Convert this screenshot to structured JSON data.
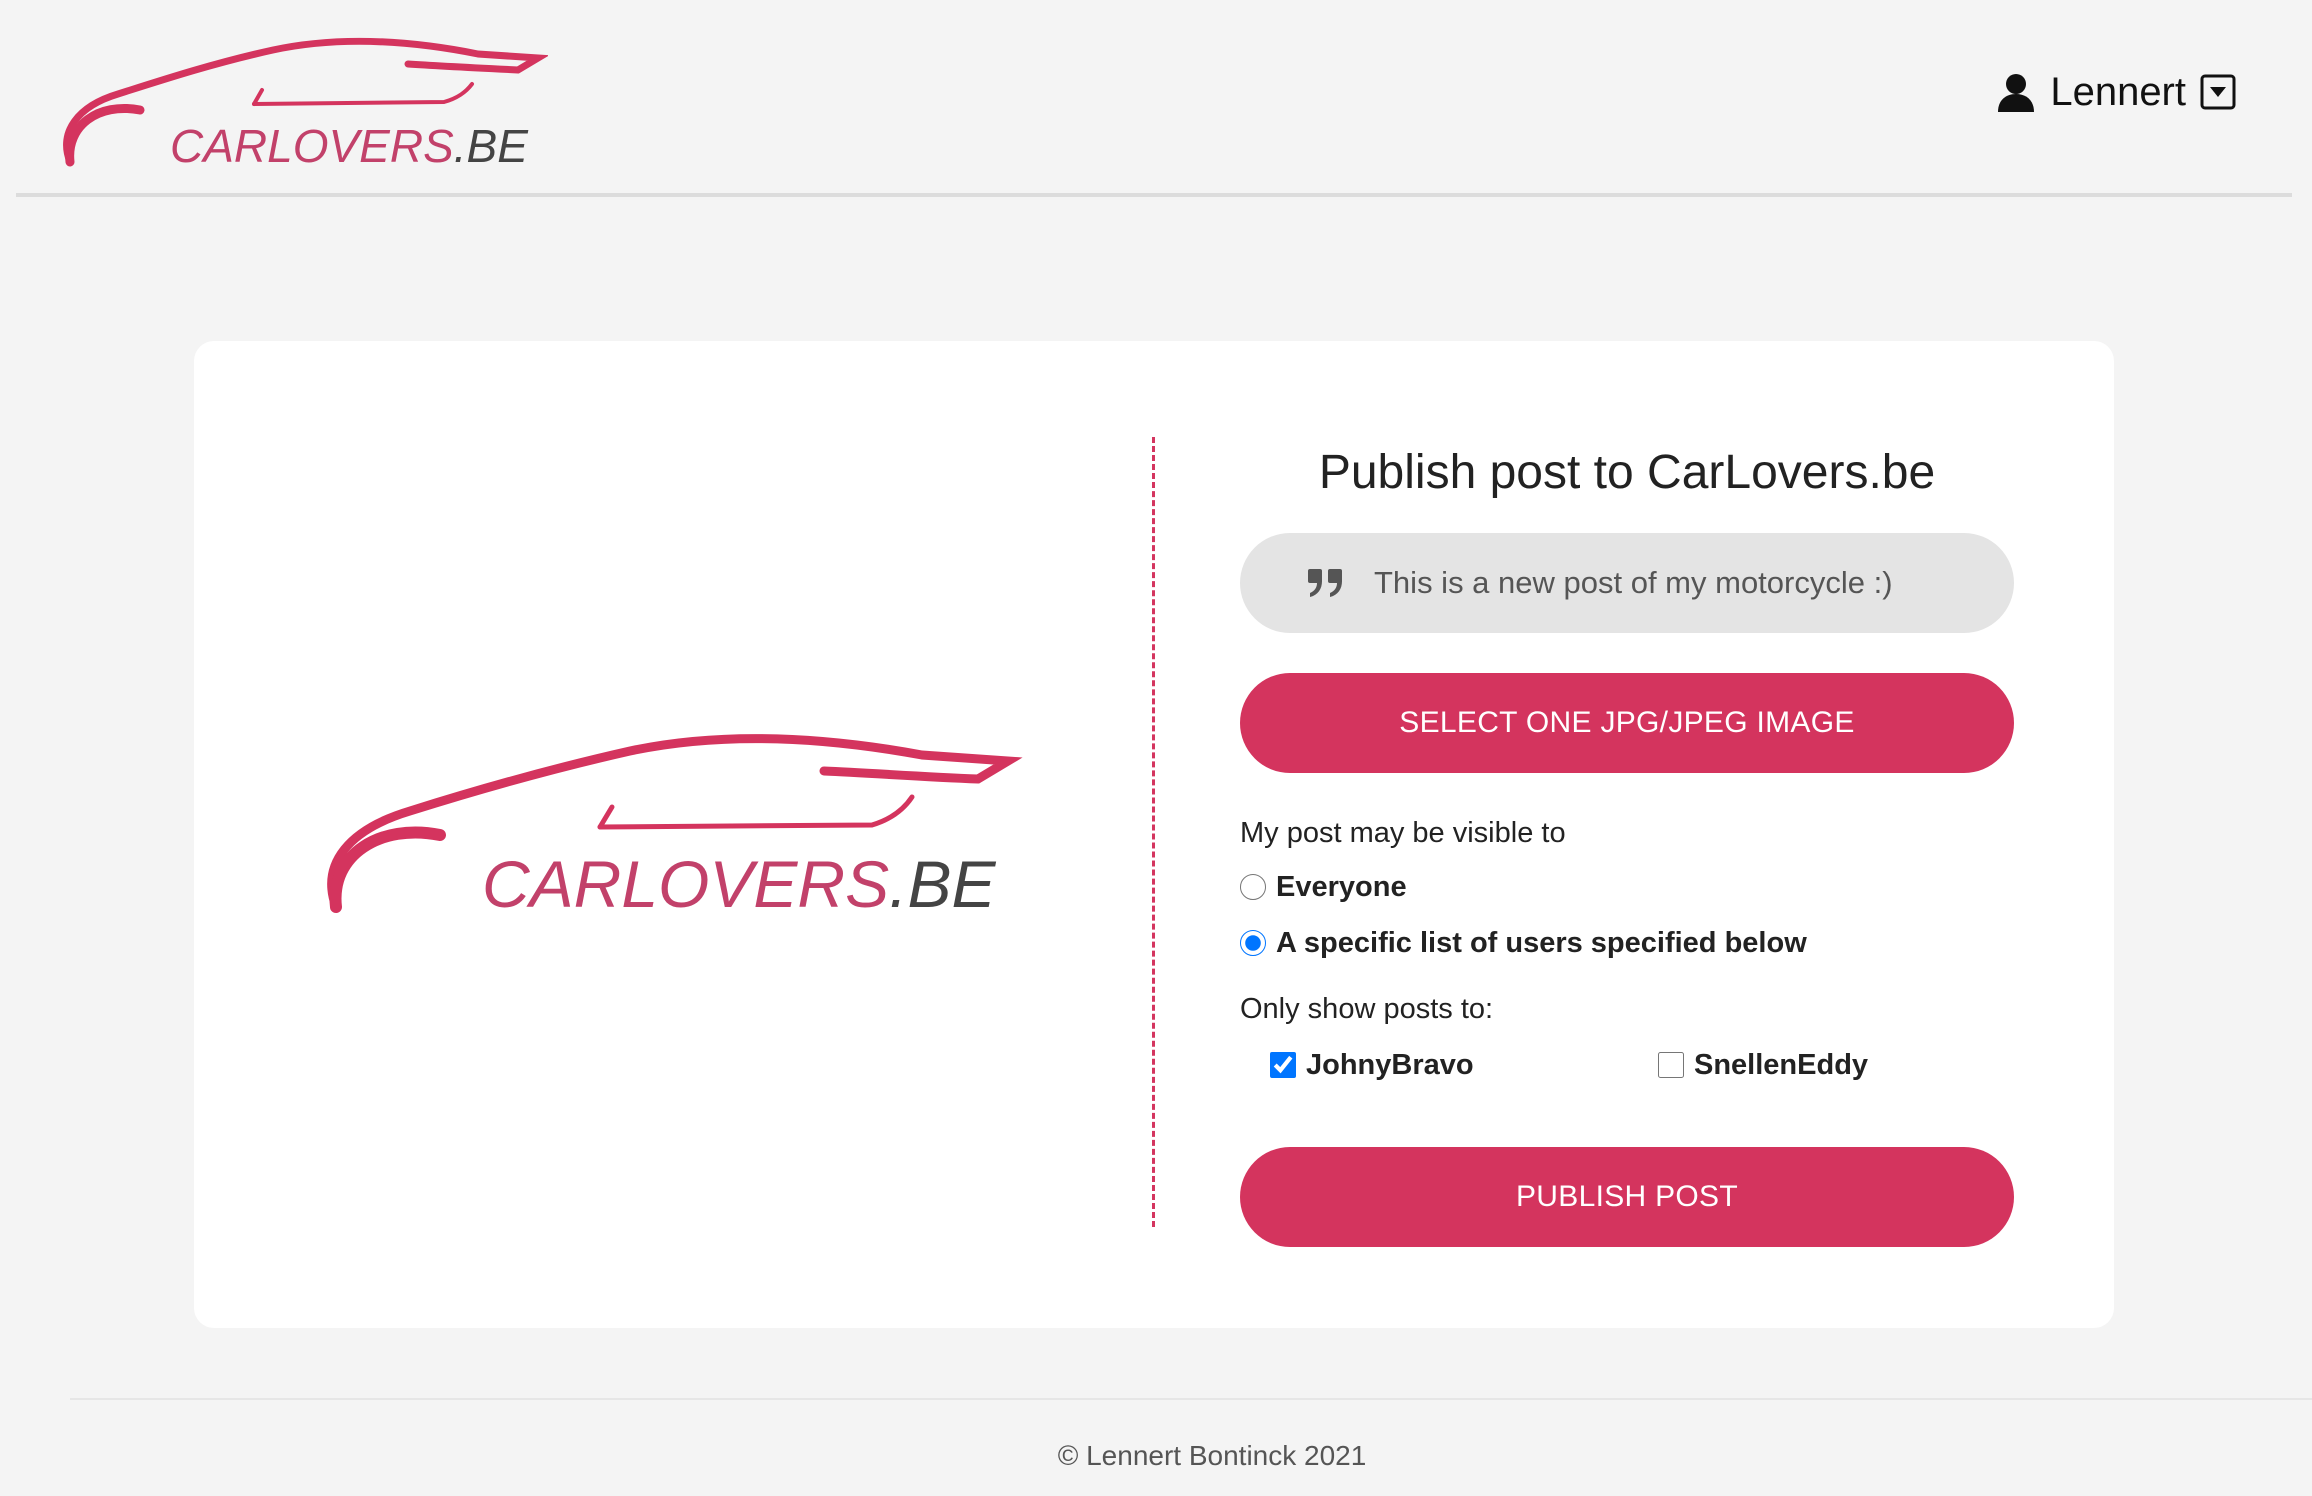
{
  "header": {
    "logo_text_main": "CARLOVERS",
    "logo_text_suffix": ".BE",
    "user_name": "Lennert",
    "user_icon": "user-icon",
    "dropdown_icon": "dropdown-caret-icon"
  },
  "brand_colors": {
    "primary": "#d4345e",
    "logo_dark": "#444444"
  },
  "card": {
    "logo_text_main": "CARLOVERS",
    "logo_text_suffix": ".BE"
  },
  "form": {
    "title": "Publish post to CarLovers.be",
    "message_value": "This is a new post of my motorcycle :)",
    "quote_icon": "quote-icon",
    "select_image_label": "SELECT ONE JPG/JPEG IMAGE",
    "visibility_label": "My post may be visible to",
    "visibility_options": [
      {
        "label": "Everyone",
        "checked": false
      },
      {
        "label": "A specific list of users specified below",
        "checked": true
      }
    ],
    "users_label": "Only show posts to:",
    "users": [
      {
        "label": "JohnyBravo",
        "checked": true
      },
      {
        "label": "SnellenEddy",
        "checked": false
      }
    ],
    "publish_label": "PUBLISH POST"
  },
  "footer": {
    "text": "© Lennert Bontinck 2021"
  }
}
